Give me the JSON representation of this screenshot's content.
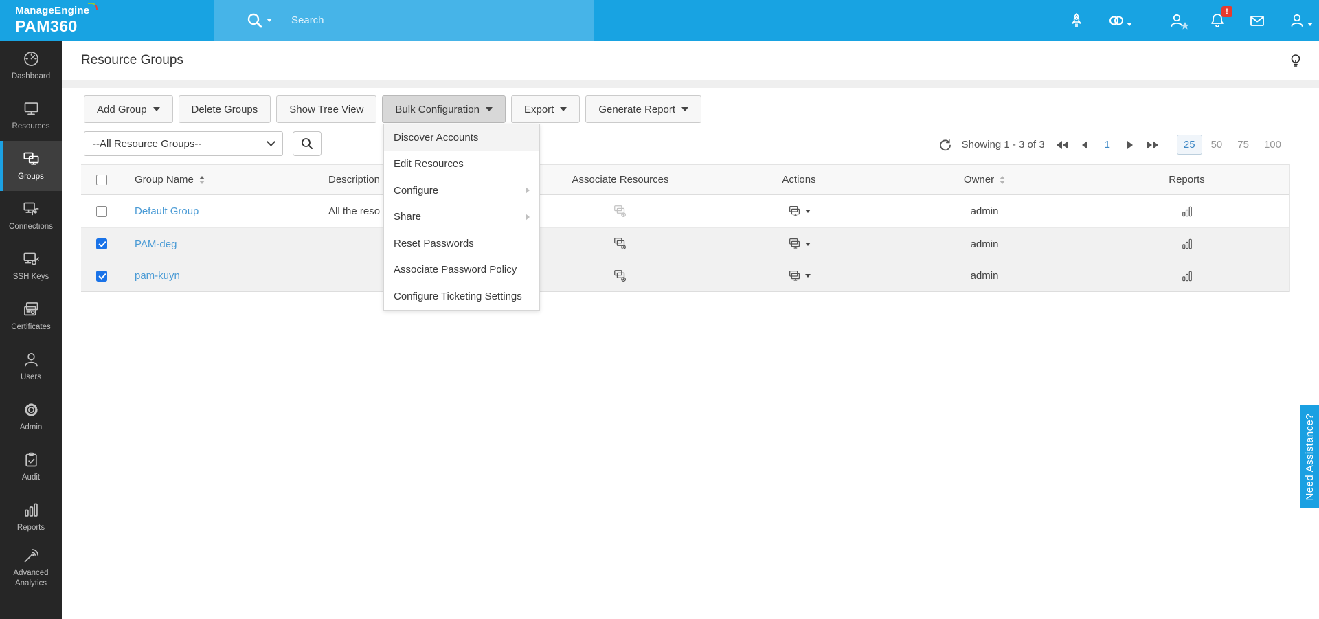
{
  "header": {
    "logo_line1": "ManageEngine",
    "logo_line2": "PAM360",
    "search_placeholder": "Search",
    "notification_badge": "!"
  },
  "sidebar": {
    "items": [
      {
        "label": "Dashboard",
        "icon": "dashboard-gauge-icon"
      },
      {
        "label": "Resources",
        "icon": "monitor-icon"
      },
      {
        "label": "Groups",
        "icon": "monitors-group-icon",
        "active": true
      },
      {
        "label": "Connections",
        "icon": "remote-connection-icon"
      },
      {
        "label": "SSH Keys",
        "icon": "ssh-key-icon"
      },
      {
        "label": "Certificates",
        "icon": "certificate-icon"
      },
      {
        "label": "Users",
        "icon": "user-icon"
      },
      {
        "label": "Admin",
        "icon": "gear-icon"
      },
      {
        "label": "Audit",
        "icon": "clipboard-check-icon"
      },
      {
        "label": "Reports",
        "icon": "bar-chart-icon"
      },
      {
        "label": "Advanced Analytics",
        "icon": "analytics-signal-icon"
      }
    ]
  },
  "page": {
    "title": "Resource Groups"
  },
  "toolbar": {
    "buttons": [
      {
        "label": "Add Group",
        "caret": true
      },
      {
        "label": "Delete Groups"
      },
      {
        "label": "Show Tree View"
      },
      {
        "label": "Bulk Configuration",
        "caret": true,
        "active": true
      },
      {
        "label": "Export",
        "caret": true
      },
      {
        "label": "Generate Report",
        "caret": true
      }
    ]
  },
  "bulk_menu": {
    "items": [
      {
        "label": "Discover Accounts",
        "hover": true
      },
      {
        "label": "Edit Resources"
      },
      {
        "label": "Configure",
        "submenu": true
      },
      {
        "label": "Share",
        "submenu": true
      },
      {
        "label": "Reset Passwords"
      },
      {
        "label": "Associate Password Policy"
      },
      {
        "label": "Configure Ticketing Settings"
      }
    ]
  },
  "filter": {
    "selected": "--All Resource Groups--"
  },
  "pagination": {
    "showing": "Showing 1 - 3 of 3",
    "current_page": "1",
    "page_sizes": [
      "25",
      "50",
      "75",
      "100"
    ],
    "active_size": "25"
  },
  "table": {
    "columns": [
      "Group Name",
      "Description",
      "Associate Resources",
      "Actions",
      "Owner",
      "Reports"
    ],
    "rows": [
      {
        "name": "Default Group",
        "description": "All the reso",
        "owner": "admin",
        "checked": false
      },
      {
        "name": "PAM-deg",
        "description": "",
        "owner": "admin",
        "checked": true
      },
      {
        "name": "pam-kuyn",
        "description": "",
        "owner": "admin",
        "checked": true
      }
    ]
  },
  "assist_tab": {
    "label": "Need Assistance?"
  },
  "colors": {
    "header_blue": "#18a3e2",
    "search_band_blue": "#46b4e8",
    "sidebar_bg": "#262626",
    "sidebar_active_accent": "#1ca1e3",
    "link_blue": "#4b9bd5",
    "checkbox_blue": "#1a73e8",
    "badge_red": "#e83a2e",
    "selected_row_gray": "#f1f1f1",
    "active_size_blue": "#3e88c5"
  }
}
